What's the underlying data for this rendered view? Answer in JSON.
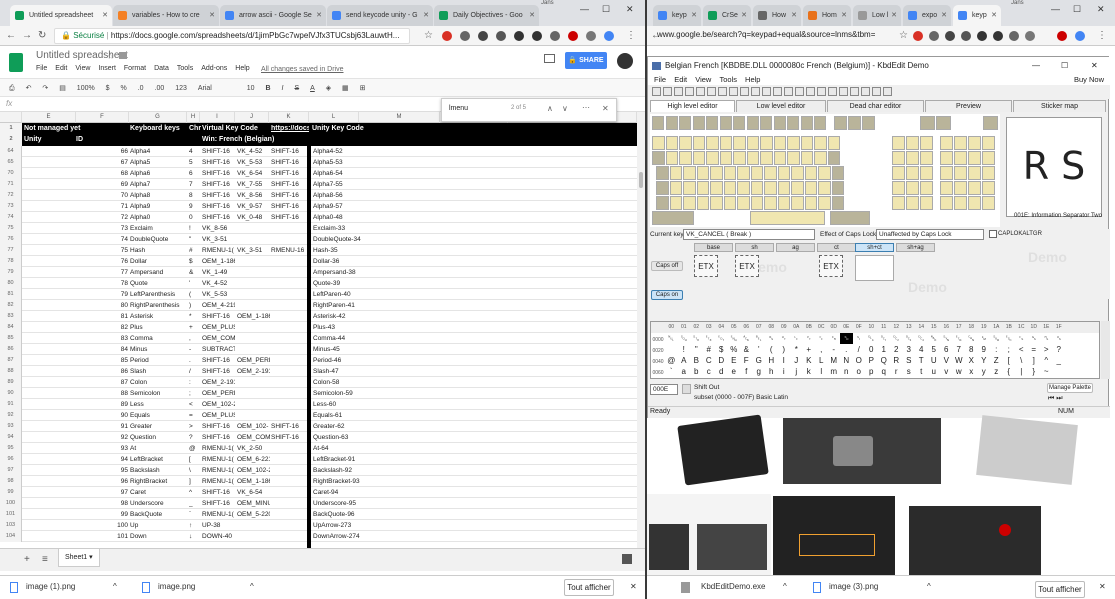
{
  "left_browser": {
    "user": "Jans",
    "tabs": [
      {
        "title": "Untitled spreadsheet",
        "color": "#0f9d58",
        "active": true
      },
      {
        "title": "variables - How to cre",
        "color": "#f48024",
        "active": false
      },
      {
        "title": "arrow ascii - Google Se",
        "color": "#4285f4",
        "active": false
      },
      {
        "title": "send keycode unity - G",
        "color": "#4285f4",
        "active": false
      },
      {
        "title": "Daily Objectives - Goo",
        "color": "#0f9d58",
        "active": false
      }
    ],
    "url_secure": "Sécurisé",
    "url": "https://docs.google.com/spreadsheets/d/1jimPbGc7wpelVJfx3TUCsbj63LauwtH..."
  },
  "sheets": {
    "title": "Untitled spreadsheet",
    "menu": [
      "File",
      "Edit",
      "View",
      "Insert",
      "Format",
      "Data",
      "Tools",
      "Add-ons",
      "Help"
    ],
    "saved_status": "All changes saved in Drive",
    "share_label": "SHARE",
    "toolbar": {
      "zoom": "100%",
      "currency": "$",
      "percent": "%",
      "dec": ".0",
      "dec2": ".00",
      "format": "123",
      "font": "Arial",
      "size": "10",
      "bold": "B",
      "italic": "I",
      "strike": "S",
      "color": "A"
    },
    "find_query": "lmenu",
    "find_count": "2 of 5",
    "col_letters": [
      "E",
      "F",
      "G",
      "H",
      "I",
      "J",
      "K",
      "L",
      "M",
      "N",
      "O"
    ],
    "header_row1": {
      "a": "Not managed yet",
      "g": "Keyboard keys",
      "h": "Chr",
      "i": "Virtual Key Code",
      "k": "https://docs.n",
      "l": "Unity Key Code"
    },
    "header_row2": {
      "a": "Unity",
      "f": "ID",
      "i": "Win: French (Belgian)"
    },
    "rows": [
      [
        "64",
        "66",
        "Alpha4",
        "4",
        "SHIFT-16",
        "VK_4-52",
        "SHIFT-16",
        "Alpha4-52"
      ],
      [
        "65",
        "67",
        "Alpha5",
        "5",
        "SHIFT-16",
        "VK_5-53",
        "SHIFT-16",
        "Alpha5-53"
      ],
      [
        "70",
        "68",
        "Alpha6",
        "6",
        "SHIFT-16",
        "VK_6-54",
        "SHIFT-16",
        "Alpha6-54"
      ],
      [
        "71",
        "69",
        "Alpha7",
        "7",
        "SHIFT-16",
        "VK_7-55",
        "SHIFT-16",
        "Alpha7-55"
      ],
      [
        "72",
        "70",
        "Alpha8",
        "8",
        "SHIFT-16",
        "VK_8-56",
        "SHIFT-16",
        "Alpha8-56"
      ],
      [
        "73",
        "71",
        "Alpha9",
        "9",
        "SHIFT-16",
        "VK_9-57",
        "SHIFT-16",
        "Alpha9-57"
      ],
      [
        "74",
        "72",
        "Alpha0",
        "0",
        "SHIFT-16",
        "VK_0-48",
        "SHIFT-16",
        "Alpha0-48"
      ],
      [
        "75",
        "73",
        "Exclaim",
        "!",
        "VK_8-56",
        "",
        "",
        "Exclaim-33"
      ],
      [
        "76",
        "74",
        "DoubleQuote",
        "\"",
        "VK_3-51",
        "",
        "",
        "DoubleQuote-34"
      ],
      [
        "77",
        "75",
        "Hash",
        "#",
        "RMENU-1(",
        "VK_3-51",
        "RMENU-16",
        "Hash-35"
      ],
      [
        "78",
        "76",
        "Dollar",
        "$",
        "OEM_1-186",
        "",
        "",
        "Dollar-36"
      ],
      [
        "79",
        "77",
        "Ampersand",
        "&",
        "VK_1-49",
        "",
        "",
        "Ampersand-38"
      ],
      [
        "80",
        "78",
        "Quote",
        "'",
        "VK_4-52",
        "",
        "",
        "Quote-39"
      ],
      [
        "81",
        "79",
        "LeftParenthesis",
        "(",
        "VK_5-53",
        "",
        "",
        "LeftParen-40"
      ],
      [
        "82",
        "80",
        "RightParenthesis",
        ")",
        "OEM_4-219",
        "",
        "",
        "RightParen-41"
      ],
      [
        "83",
        "81",
        "Asterisk",
        "*",
        "SHIFT-16",
        "OEM_1-186",
        "",
        "Asterisk-42"
      ],
      [
        "84",
        "82",
        "Plus",
        "+",
        "OEM_PLUS-187",
        "",
        "",
        "Plus-43"
      ],
      [
        "85",
        "83",
        "Comma",
        ",",
        "OEM_COMMA-188",
        "",
        "",
        "Comma-44"
      ],
      [
        "86",
        "84",
        "Minus",
        "-",
        "SUBTRACT-109",
        "",
        "",
        "Minus-45"
      ],
      [
        "87",
        "85",
        "Period",
        ".",
        "SHIFT-16",
        "OEM_PERIOD-190",
        "",
        "Period-46"
      ],
      [
        "88",
        "86",
        "Slash",
        "/",
        "SHIFT-16",
        "OEM_2-191",
        "",
        "Slash-47"
      ],
      [
        "89",
        "87",
        "Colon",
        ":",
        "OEM_2-191",
        "",
        "",
        "Colon-58"
      ],
      [
        "90",
        "88",
        "Semicolon",
        ";",
        "OEM_PERIOD-190",
        "",
        "",
        "Semicolon-59"
      ],
      [
        "91",
        "89",
        "Less",
        "<",
        "OEM_102-226",
        "",
        "",
        "Less-60"
      ],
      [
        "92",
        "90",
        "Equals",
        "=",
        "OEM_PLUS-187",
        "",
        "",
        "Equals-61"
      ],
      [
        "93",
        "91",
        "Greater",
        ">",
        "SHIFT-16",
        "OEM_102-",
        "SHIFT-16",
        "Greater-62"
      ],
      [
        "94",
        "92",
        "Question",
        "?",
        "SHIFT-16",
        "OEM_COM",
        "SHIFT-16",
        "Question-63"
      ],
      [
        "95",
        "93",
        "At",
        "@",
        "RMENU-1(",
        "VK_2-50",
        "",
        "At-64"
      ],
      [
        "96",
        "94",
        "LeftBracket",
        "[",
        "RMENU-1(",
        "OEM_6-221",
        "",
        "LeftBracket-91"
      ],
      [
        "97",
        "95",
        "Backslash",
        "\\",
        "RMENU-1(",
        "OEM_102-226",
        "",
        "Backslash-92"
      ],
      [
        "98",
        "96",
        "RightBracket",
        "]",
        "RMENU-1(",
        "OEM_1-186",
        "",
        "RightBracket-93"
      ],
      [
        "99",
        "97",
        "Caret",
        "^",
        "SHIFT-16",
        "VK_6-54",
        "",
        "Caret-94"
      ],
      [
        "100",
        "98",
        "Underscore",
        "_",
        "SHIFT-16",
        "OEM_MINUS-189",
        "",
        "Underscore-95"
      ],
      [
        "101",
        "99",
        "BackQuote",
        "`",
        "RMENU-1(",
        "OEM_5-220",
        "",
        "BackQuote-96"
      ],
      [
        "103",
        "100",
        "Up",
        "↑",
        "UP-38",
        "",
        "",
        "UpArrow-273"
      ],
      [
        "104",
        "101",
        "Down",
        "↓",
        "DOWN-40",
        "",
        "",
        "DownArrow-274"
      ]
    ],
    "sheet_tab": "Sheet1",
    "downloads": [
      "image (1).png",
      "image.png"
    ],
    "show_all": "Tout afficher"
  },
  "right_browser": {
    "user": "Jans",
    "tabs": [
      "keyp",
      "CrSe",
      "How",
      "Hom",
      "Low l",
      "expo",
      "keyp"
    ],
    "url": "www.google.be/search?q=keypad+equal&source=lnms&tbm=..."
  },
  "kbdedit": {
    "title": "Belgian French [KBDBE.DLL 0000080c French (Belgium)] - KbdEdit Demo",
    "menu": [
      "File",
      "Edit",
      "View",
      "Tools",
      "Help"
    ],
    "buy_now": "Buy Now",
    "tabs": [
      "High level editor",
      "Low level editor",
      "Dead char editor",
      "Preview",
      "Sticker map"
    ],
    "big_char": "R S",
    "big_char_desc": "001E: Information Separator Two",
    "current_key_label": "Current key",
    "current_key": "VK_CANCEL ( Break )",
    "effect_label": "Effect of Caps Lock",
    "effect_value": "Unaffected by Caps Lock",
    "capslock_check": "CAPLOKALTGR",
    "state_cols": [
      "base",
      "sh",
      "ag",
      "ct",
      "sh+ct",
      "sh+ag"
    ],
    "etx": "ETX",
    "caps_off": "Caps off",
    "caps_on": "Caps on",
    "demo_watermark": "Demo",
    "charmap_rows": [
      {
        "hx": "0000",
        "chars": "␀␁␂␃␄␅␆␇␈␉␊␋␌␍␎␏␐␑␒␓␔␕␖␗␘␙␚␛␜␝␞␟"
      },
      {
        "hx": "0020",
        "chars": " !\"#$%&'()*+,-./0123456789:;<=>?"
      },
      {
        "hx": "0040",
        "chars": "@ABCDEFGHIJKLMNOPQRSTUVWXYZ[\\]^_"
      },
      {
        "hx": "0060",
        "chars": "`abcdefghijklmnopqrstuvwxyz{|}~"
      }
    ],
    "code_value": "000E",
    "shift_out": "Shift Out",
    "subset": "subset (0000 - 007F) Basic Latin",
    "manage_palette": "Manage Palette",
    "status_ready": "Ready",
    "status_num": "NUM"
  },
  "right_downloads": [
    "KbdEditDemo.exe",
    "image (3).png"
  ],
  "right_show_all": "Tout afficher"
}
